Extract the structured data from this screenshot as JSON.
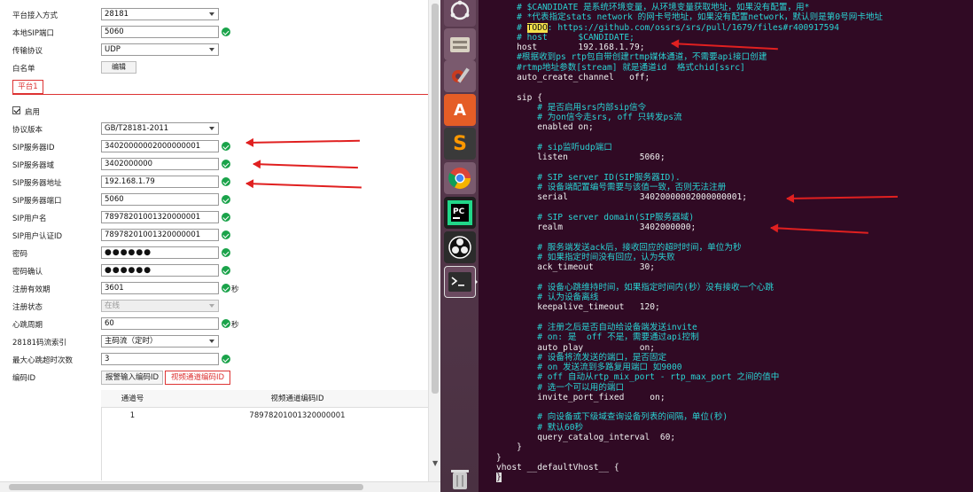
{
  "form": {
    "rows": [
      {
        "label": "平台接入方式",
        "value": "28181",
        "type": "select"
      },
      {
        "label": "本地SIP端口",
        "value": "5060",
        "type": "input",
        "ok": true
      },
      {
        "label": "传输协议",
        "value": "UDP",
        "type": "select"
      },
      {
        "label": "白名单",
        "button": "编辑",
        "type": "button"
      }
    ],
    "platform_tab": "平台1",
    "enable_label": "启用",
    "fields": [
      {
        "label": "协议版本",
        "value": "GB/T28181-2011",
        "type": "select"
      },
      {
        "label": "SIP服务器ID",
        "value": "34020000002000000001",
        "type": "input",
        "ok": true
      },
      {
        "label": "SIP服务器域",
        "value": "3402000000",
        "type": "input",
        "ok": true
      },
      {
        "label": "SIP服务器地址",
        "value": "192.168.1.79",
        "type": "input",
        "ok": true
      },
      {
        "label": "SIP服务器端口",
        "value": "5060",
        "type": "input",
        "ok": true
      },
      {
        "label": "SIP用户名",
        "value": "78978201001320000001",
        "type": "input",
        "ok": true
      },
      {
        "label": "SIP用户认证ID",
        "value": "78978201001320000001",
        "type": "input",
        "ok": true
      },
      {
        "label": "密码",
        "value": "●●●●●●",
        "type": "password",
        "ok": true
      },
      {
        "label": "密码确认",
        "value": "●●●●●●",
        "type": "password",
        "ok": true
      },
      {
        "label": "注册有效期",
        "value": "3601",
        "type": "input",
        "ok": true,
        "unit": "秒"
      },
      {
        "label": "注册状态",
        "value": "在线",
        "type": "select-disabled"
      },
      {
        "label": "心跳周期",
        "value": "60",
        "type": "input",
        "ok": true,
        "unit": "秒"
      },
      {
        "label": "28181码流索引",
        "value": "主码流（定时）",
        "type": "select"
      },
      {
        "label": "最大心跳超时次数",
        "value": "3",
        "type": "input",
        "ok": true
      }
    ],
    "code_label": "编码ID",
    "code_tabs": [
      "报警输入编码ID",
      "视频通道编码ID"
    ],
    "table": {
      "headers": [
        "通道号",
        "视频通道编码ID"
      ],
      "rows": [
        [
          "1",
          "78978201001320000001"
        ]
      ]
    }
  },
  "terminal": {
    "lines": [
      {
        "t": "    # $CANDIDATE 是系统环境变量，从环境变量获取地址，如果没有配置，用*",
        "c": true
      },
      {
        "t": "    # *代表指定stats network 的网卡号地址，如果没有配置network，默认则是第0号网卡地址",
        "c": true
      },
      {
        "t": "    # ",
        "c": true,
        "todo": "TODO",
        "rest": ": https://github.com/ossrs/srs/pull/1679/files#r400917594"
      },
      {
        "t": "    # host      $CANDIDATE;",
        "c": true
      },
      {
        "t": "    host        192.168.1.79;",
        "c": false
      },
      {
        "t": "    #根据收到ps rtp包自带创建rtmp媒体通道，不需要api接口创建",
        "c": true
      },
      {
        "t": "    #rtmp地址参数[stream] 就是通道id  格式chid[ssrc]",
        "c": true
      },
      {
        "t": "    auto_create_channel   off;",
        "c": false
      },
      {
        "t": "",
        "c": false
      },
      {
        "t": "    sip {",
        "c": false
      },
      {
        "t": "        # 是否启用srs内部sip信令",
        "c": true
      },
      {
        "t": "        # 为on信令走srs, off 只转发ps流",
        "c": true
      },
      {
        "t": "        enabled on;",
        "c": false
      },
      {
        "t": "",
        "c": false
      },
      {
        "t": "        # sip监听udp端口",
        "c": true
      },
      {
        "t": "        listen              5060;",
        "c": false
      },
      {
        "t": "",
        "c": false
      },
      {
        "t": "        # SIP server ID(SIP服务器ID).",
        "c": true
      },
      {
        "t": "        # 设备端配置编号需要与该值一致，否则无法注册",
        "c": true
      },
      {
        "t": "        serial              34020000002000000001;",
        "c": false
      },
      {
        "t": "",
        "c": false
      },
      {
        "t": "        # SIP server domain(SIP服务器域)",
        "c": true
      },
      {
        "t": "        realm               3402000000;",
        "c": false
      },
      {
        "t": "",
        "c": false
      },
      {
        "t": "        # 服务端发送ack后，接收回应的超时时间，单位为秒",
        "c": true
      },
      {
        "t": "        # 如果指定时间没有回应，认为失败",
        "c": true
      },
      {
        "t": "        ack_timeout         30;",
        "c": false
      },
      {
        "t": "",
        "c": false
      },
      {
        "t": "        # 设备心跳维持时间，如果指定时间内(秒）没有接收一个心跳",
        "c": true
      },
      {
        "t": "        # 认为设备离线",
        "c": true
      },
      {
        "t": "        keepalive_timeout   120;",
        "c": false
      },
      {
        "t": "",
        "c": false
      },
      {
        "t": "        # 注册之后是否自动给设备端发送invite",
        "c": true
      },
      {
        "t": "        # on: 是  off 不是，需要通过api控制",
        "c": true
      },
      {
        "t": "        auto_play           on;",
        "c": false
      },
      {
        "t": "        # 设备将流发送的端口，是否固定",
        "c": true
      },
      {
        "t": "        # on 发送流到多路复用端口 如9000",
        "c": true
      },
      {
        "t": "        # off 自动从rtp_mix_port - rtp_max_port 之间的值中",
        "c": true
      },
      {
        "t": "        # 选一个可以用的端口",
        "c": true
      },
      {
        "t": "        invite_port_fixed     on;",
        "c": false
      },
      {
        "t": "",
        "c": false
      },
      {
        "t": "        # 向设备或下级域查询设备列表的间隔，单位(秒)",
        "c": true
      },
      {
        "t": "        # 默认60秒",
        "c": true
      },
      {
        "t": "        query_catalog_interval  60;",
        "c": false
      },
      {
        "t": "    }",
        "c": false
      },
      {
        "t": "}",
        "c": false
      },
      {
        "t": "vhost __defaultVhost__ {",
        "c": false
      },
      {
        "t": "}",
        "c": false,
        "cursor": true
      }
    ]
  },
  "launcher_icons": [
    "ubuntu-dash-icon",
    "file-manager-icon",
    "system-settings-icon",
    "software-center-icon",
    "sublime-text-icon",
    "chrome-icon",
    "pycharm-icon",
    "obs-icon",
    "terminal-icon",
    "trash-icon"
  ],
  "colors": {
    "terminal_bg": "#300a24",
    "comment": "#2ad4d4",
    "accent_red": "#d33",
    "ok_green": "#1aa34a"
  }
}
